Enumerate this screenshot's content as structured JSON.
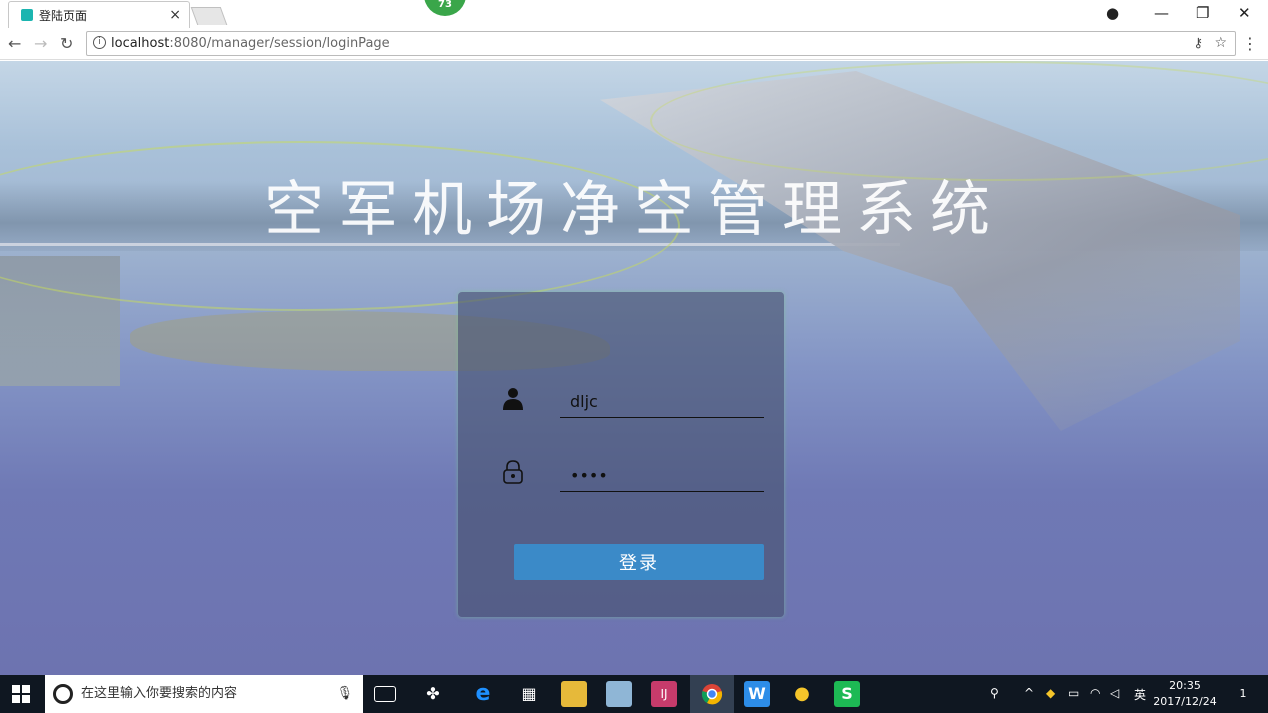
{
  "browser": {
    "tab_title": "登陆页面",
    "tab_close": "×",
    "badge": "73",
    "url_host": "localhost",
    "url_path": ":8080/manager/session/loginPage"
  },
  "page": {
    "title": "空军机场净空管理系统",
    "username_value": "dljc",
    "password_value": "••••",
    "login_button": "登录"
  },
  "taskbar": {
    "search_placeholder": "在这里输入你要搜索的内容",
    "ime": "英",
    "time": "20:35",
    "date": "2017/12/24",
    "notifications": "1"
  },
  "colors": {
    "accent": "#3b8ac8",
    "panel": "#465070",
    "taskbar": "#0f1721"
  }
}
